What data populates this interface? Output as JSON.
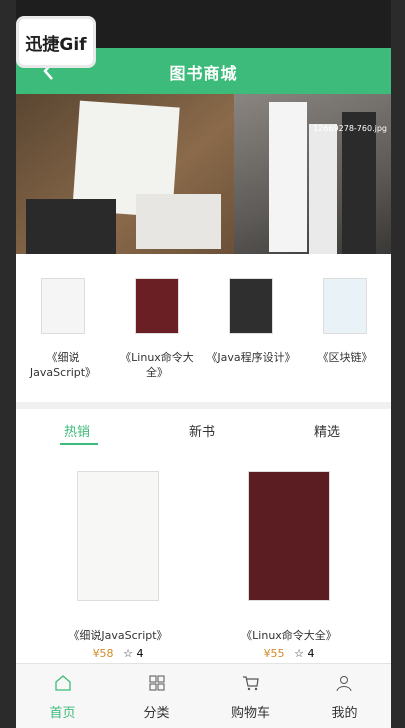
{
  "watermark": "迅捷Gif",
  "header": {
    "title": "图书商城"
  },
  "banner": {
    "caption": "12669278-760.jpg"
  },
  "categories": [
    {
      "label": "《细说JavaScript》"
    },
    {
      "label": "《Linux命令大全》"
    },
    {
      "label": "《Java程序设计》"
    },
    {
      "label": "《区块链》"
    }
  ],
  "tabs": [
    {
      "label": "热销"
    },
    {
      "label": "新书"
    },
    {
      "label": "精选"
    }
  ],
  "products": [
    {
      "name": "《细说JavaScript》",
      "price": "¥58",
      "rating": "4"
    },
    {
      "name": "《Linux命令大全》",
      "price": "¥55",
      "rating": "4"
    }
  ],
  "nav": [
    {
      "label": "首页",
      "icon": "home-icon"
    },
    {
      "label": "分类",
      "icon": "grid-icon"
    },
    {
      "label": "购物车",
      "icon": "cart-icon"
    },
    {
      "label": "我的",
      "icon": "user-icon"
    }
  ],
  "colors": {
    "accent": "#3dbb7a",
    "price": "#d38b2b"
  }
}
